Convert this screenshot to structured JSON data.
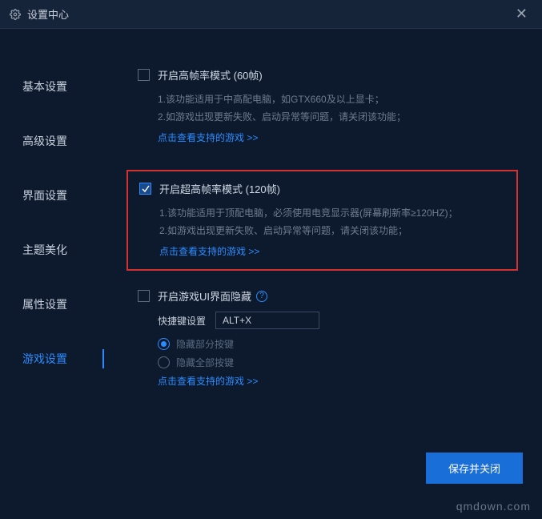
{
  "window": {
    "title": "设置中心"
  },
  "sidebar": {
    "items": [
      {
        "label": "基本设置"
      },
      {
        "label": "高级设置"
      },
      {
        "label": "界面设置"
      },
      {
        "label": "主题美化"
      },
      {
        "label": "属性设置"
      },
      {
        "label": "游戏设置"
      }
    ]
  },
  "settings": {
    "fps60": {
      "label": "开启高帧率模式 (60帧)",
      "desc1": "1.该功能适用于中高配电脑，如GTX660及以上显卡；",
      "desc2": "2.如游戏出现更新失败、启动异常等问题，请关闭该功能；",
      "link": "点击查看支持的游戏 >>"
    },
    "fps120": {
      "label": "开启超高帧率模式 (120帧)",
      "desc1": "1.该功能适用于顶配电脑，必须使用电竞显示器(屏幕刷新率≥120HZ)；",
      "desc2": "2.如游戏出现更新失败、启动异常等问题，请关闭该功能；",
      "link": "点击查看支持的游戏 >>"
    },
    "hideUI": {
      "label": "开启游戏UI界面隐藏",
      "help": "?",
      "hotkey_label": "快捷键设置",
      "hotkey_value": "ALT+X",
      "radio1": "隐藏部分按键",
      "radio2": "隐藏全部按键",
      "link": "点击查看支持的游戏 >>"
    }
  },
  "footer": {
    "save": "保存并关闭"
  },
  "watermark": "qmdown.com"
}
